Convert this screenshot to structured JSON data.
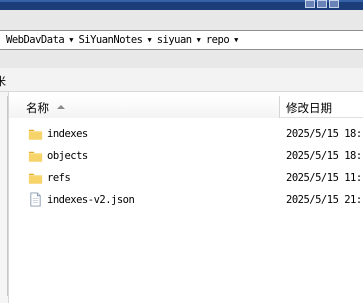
{
  "address_bar": {
    "crumbs": [
      "WebDavData",
      "SiYuanNotes",
      "siyuan",
      "repo"
    ]
  },
  "toolbar": {
    "partial_label": "米"
  },
  "columns": {
    "name": "名称",
    "date_modified": "修改日期",
    "sort": "ascending"
  },
  "files": [
    {
      "name": "indexes",
      "type": "folder",
      "date": "2025/5/15 18:"
    },
    {
      "name": "objects",
      "type": "folder",
      "date": "2025/5/15 18:"
    },
    {
      "name": "refs",
      "type": "folder",
      "date": "2025/5/15 11:"
    },
    {
      "name": "indexes-v2.json",
      "type": "file",
      "date": "2025/5/15 21:"
    }
  ],
  "colors": {
    "titlebar": "#1b3d7a",
    "folder": "#f2c94c"
  }
}
